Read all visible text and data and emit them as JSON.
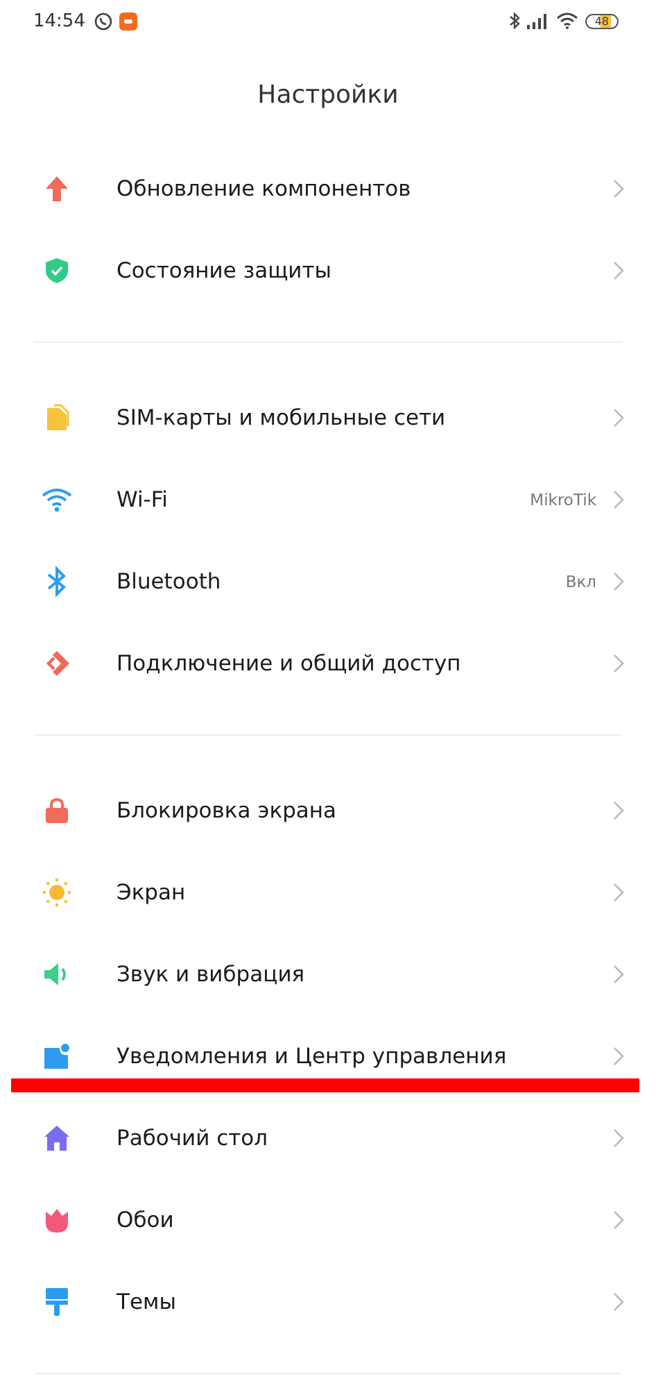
{
  "status_bar": {
    "time": "14:54",
    "battery": "48"
  },
  "title": "Настройки",
  "sections": [
    {
      "items": [
        {
          "label": "Обновление компонентов"
        },
        {
          "label": "Состояние защиты"
        }
      ]
    },
    {
      "items": [
        {
          "label": "SIM-карты и мобильные сети"
        },
        {
          "label": "Wi-Fi",
          "value": "MikroTik"
        },
        {
          "label": "Bluetooth",
          "value": "Вкл"
        },
        {
          "label": "Подключение и общий доступ"
        }
      ]
    },
    {
      "items": [
        {
          "label": "Блокировка экрана"
        },
        {
          "label": "Экран"
        },
        {
          "label": "Звук и вибрация"
        },
        {
          "label": "Уведомления и Центр управления",
          "marked": true
        },
        {
          "label": "Рабочий стол"
        },
        {
          "label": "Обои"
        },
        {
          "label": "Темы"
        }
      ]
    }
  ]
}
